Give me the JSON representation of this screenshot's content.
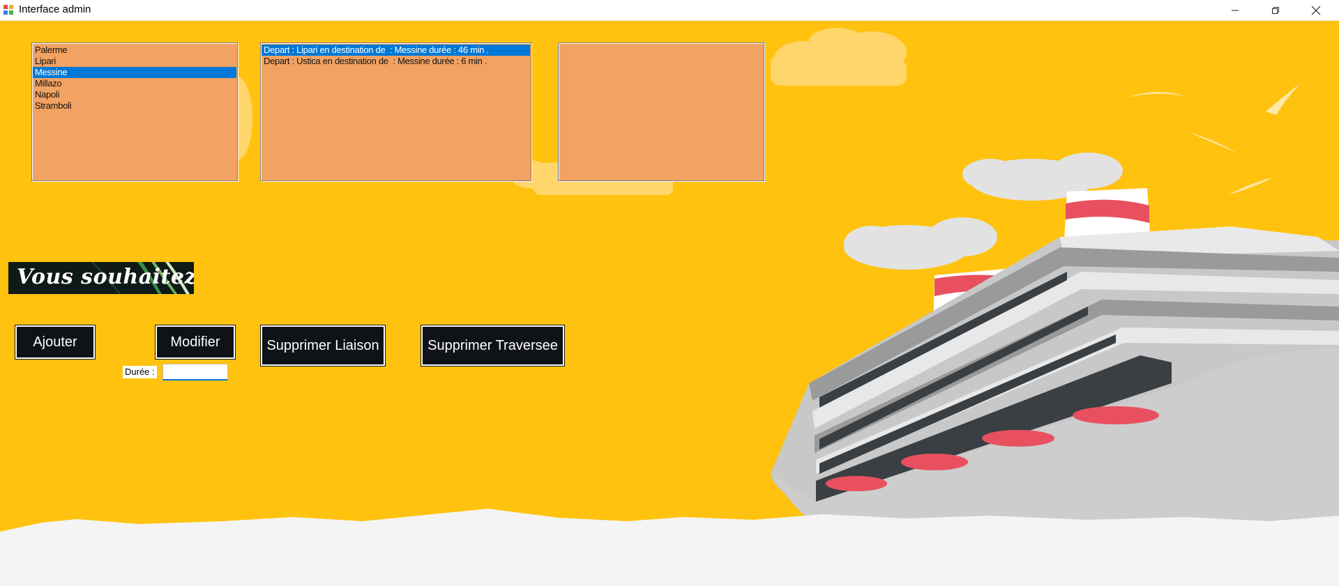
{
  "window": {
    "title": "Interface admin",
    "controls": [
      "minimize-icon",
      "restore-icon",
      "close-icon"
    ]
  },
  "lists": {
    "ports": {
      "items": [
        "Palerme",
        "Lipari",
        "Messine",
        "Millazo",
        "Napoli",
        "Stramboli"
      ],
      "selected_index": 2
    },
    "liaisons": {
      "items": [
        "Depart : Lipari en destination de  : Messine durée : 46 min .",
        "Depart : Ustica en destination de  : Messine durée : 6 min ."
      ],
      "selected_index": 0
    },
    "traversees": {
      "items": []
    }
  },
  "banner": {
    "text": "Vous souhaitez :"
  },
  "buttons": {
    "ajouter": "Ajouter",
    "modifier": "Modifier",
    "supprimer_liaison": "Supprimer Liaison",
    "supprimer_traversee": "Supprimer Traversee"
  },
  "duree": {
    "label": "Durée :",
    "value": ""
  },
  "colors": {
    "background": "#FFC20E",
    "listbox": "#F2A262",
    "selection": "#0078D7",
    "button": "#0f1217",
    "sea": "#f4f4f4",
    "ship_red": "#e9505f"
  }
}
